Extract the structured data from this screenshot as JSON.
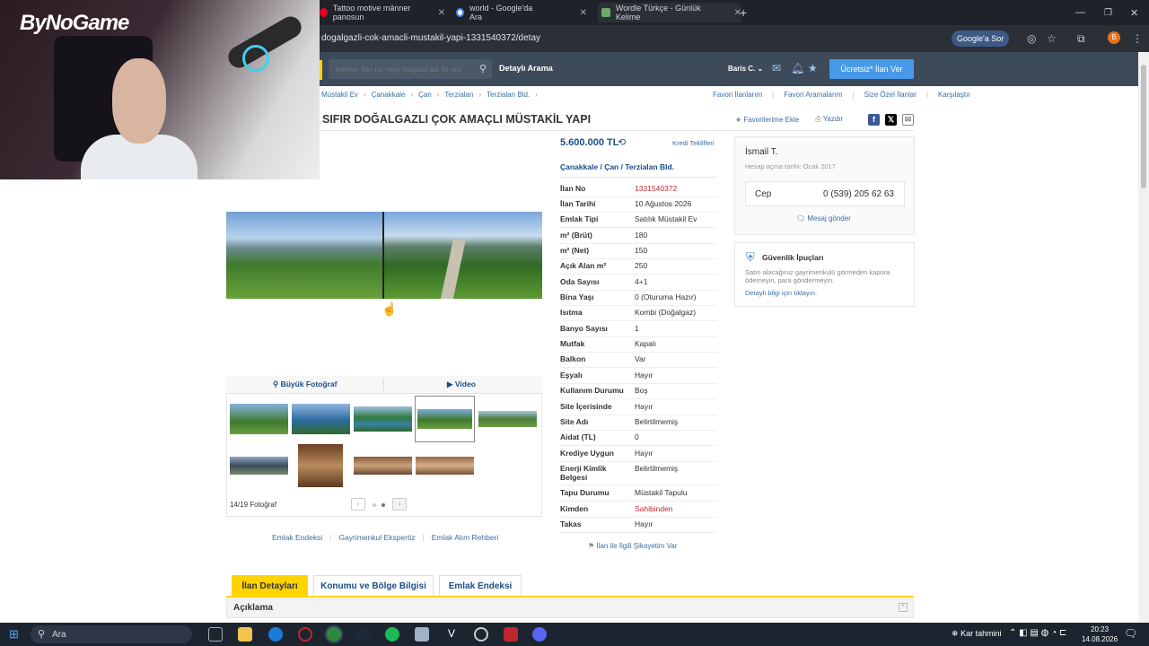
{
  "browser": {
    "tabs": [
      {
        "title": "Tattoo motive männer panosun",
        "color": "#e60023"
      },
      {
        "title": "world - Google'da Ara",
        "color": "#4285f4"
      },
      {
        "title": "Wordle Türkçe - Günlük Kelime",
        "color": "#6aaa64"
      }
    ],
    "url": "dogalgazli-cok-amacli-mustakil-yapi-1331540372/detay",
    "google_sor": "Google'a Sor",
    "profile_letter": "B"
  },
  "header": {
    "search_placeholder": "Kelime, ilan no veya mağaza adı ile ara",
    "detayli_arama": "Detaylı Arama",
    "user": "Baris C.",
    "ilan_ver": "Ücretsiz* İlan Ver"
  },
  "breadcrumbs": [
    "Müstakil Ev",
    "Çanakkale",
    "Çan",
    "Terzialan",
    "Terzialan Bld."
  ],
  "top_links": [
    "Favori İlanlarım",
    "Favori Aramalarım",
    "Size Özel İlanlar",
    "Karşılaştır"
  ],
  "listing": {
    "title": "SIFIR DOĞALGAZLI ÇOK AMAÇLI MÜSTAKİL YAPI",
    "favorite": "Favorilerime Ekle",
    "print": "Yazdır",
    "price": "5.600.000 TL",
    "kredi": "Kredi Teklifleri",
    "location": [
      "Çanakkale",
      "Çan",
      "Terzialan Bld."
    ],
    "location_sep": "/",
    "props": [
      {
        "k": "İlan No",
        "v": "1331540372",
        "red": true
      },
      {
        "k": "İlan Tarihi",
        "v": "10 Ağustos 2026"
      },
      {
        "k": "Emlak Tipi",
        "v": "Satılık Müstakil Ev"
      },
      {
        "k": "m² (Brüt)",
        "v": "180"
      },
      {
        "k": "m² (Net)",
        "v": "150"
      },
      {
        "k": "Açık Alan m²",
        "v": "250"
      },
      {
        "k": "Oda Sayısı",
        "v": "4+1"
      },
      {
        "k": "Bina Yaşı",
        "v": "0 (Oturuma Hazır)"
      },
      {
        "k": "Isıtma",
        "v": "Kombi (Doğalgaz)"
      },
      {
        "k": "Banyo Sayısı",
        "v": "1"
      },
      {
        "k": "Mutfak",
        "v": "Kapalı"
      },
      {
        "k": "Balkon",
        "v": "Var"
      },
      {
        "k": "Eşyalı",
        "v": "Hayır"
      },
      {
        "k": "Kullanım Durumu",
        "v": "Boş"
      },
      {
        "k": "Site İçerisinde",
        "v": "Hayır"
      },
      {
        "k": "Site Adı",
        "v": "Belirtilmemiş"
      },
      {
        "k": "Aidat (TL)",
        "v": "0"
      },
      {
        "k": "Krediye Uygun",
        "v": "Hayır"
      },
      {
        "k": "Enerji Kimlik Belgesi",
        "v": "Belirtilmemiş"
      },
      {
        "k": "Tapu Durumu",
        "v": "Müstakil Tapulu"
      },
      {
        "k": "Kimden",
        "v": "Sahibinden",
        "red": true
      },
      {
        "k": "Takas",
        "v": "Hayır"
      }
    ],
    "sikayet": "İlan ile İlgili Şikayetim Var"
  },
  "photos": {
    "buyuk_foto": "Büyük Fotoğraf",
    "video": "Video",
    "count": "14/19 Fotoğraf",
    "pager_prev": "‹",
    "pager_next": "›"
  },
  "bottom_links": [
    "Emlak Endeksi",
    "Gayrimenkul Ekspertiz",
    "Emlak Alım Rehberi"
  ],
  "seller": {
    "name": "İsmail T.",
    "since": "Hesap açma tarihi: Ocak 2017",
    "phone_label": "Cep",
    "phone": "0 (539) 205 62 63",
    "mesaj": "Mesaj gönder"
  },
  "guvenlik": {
    "title": "Güvenlik İpuçları",
    "text": "Satın alacağınız gayrimenkulü görmeden kapora ödemeyin, para göndermeyin.",
    "link": "Detaylı bilgi için tıklayın."
  },
  "bottom_tabs": [
    "İlan Detayları",
    "Konumu ve Bölge Bilgisi",
    "Emlak Endeksi"
  ],
  "aciklama": "Açıklama",
  "webcam": {
    "logo": "ByNoGame"
  },
  "taskbar": {
    "search": "Ara",
    "weather": "Kar tahmini",
    "time": "20:23",
    "date": "14.08.2026"
  },
  "colors": {
    "accent_yellow": "#ffd400",
    "link_blue": "#3a6ea5",
    "header_bg": "#3d4a5a",
    "cta_blue": "#489ae9"
  }
}
